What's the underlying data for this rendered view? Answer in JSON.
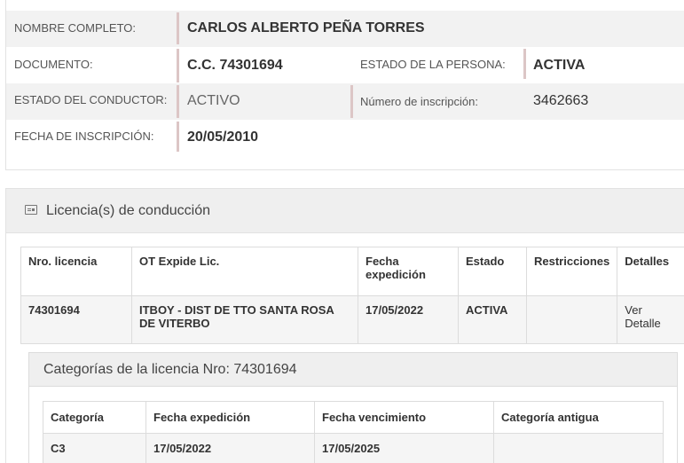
{
  "person": {
    "nombre_label": "NOMBRE COMPLETO:",
    "nombre_value": "CARLOS ALBERTO PEÑA TORRES",
    "documento_label": "DOCUMENTO:",
    "documento_value": "C.C. 74301694",
    "estado_persona_label": "ESTADO DE LA PERSONA:",
    "estado_persona_value": "ACTIVA",
    "estado_conductor_label": "ESTADO DEL CONDUCTOR:",
    "estado_conductor_value": "ACTIVO",
    "inscripcion_num_label": "Número de inscripción:",
    "inscripcion_num_value": "3462663",
    "fecha_inscripcion_label": "FECHA DE INSCRIPCIÓN:",
    "fecha_inscripcion_value": "20/05/2010"
  },
  "licencias": {
    "title": "Licencia(s) de conducción",
    "icon": "id-card-icon",
    "columns": [
      "Nro. licencia",
      "OT Expide Lic.",
      "Fecha expedición",
      "Estado",
      "Restricciones",
      "Detalles"
    ],
    "rows": [
      {
        "nro": "74301694",
        "ot": "ITBOY - DIST DE TTO SANTA ROSA DE VITERBO",
        "fecha": "17/05/2022",
        "estado": "ACTIVA",
        "restricciones": "",
        "detalles": "Ver Detalle"
      }
    ]
  },
  "categorias": {
    "title": "Categorías de la licencia Nro: 74301694",
    "columns": [
      "Categoría",
      "Fecha expedición",
      "Fecha vencimiento",
      "Categoría antigua"
    ],
    "rows": [
      {
        "categoria": "C3",
        "expedicion": "17/05/2022",
        "vencimiento": "17/05/2025",
        "antigua": ""
      }
    ]
  }
}
